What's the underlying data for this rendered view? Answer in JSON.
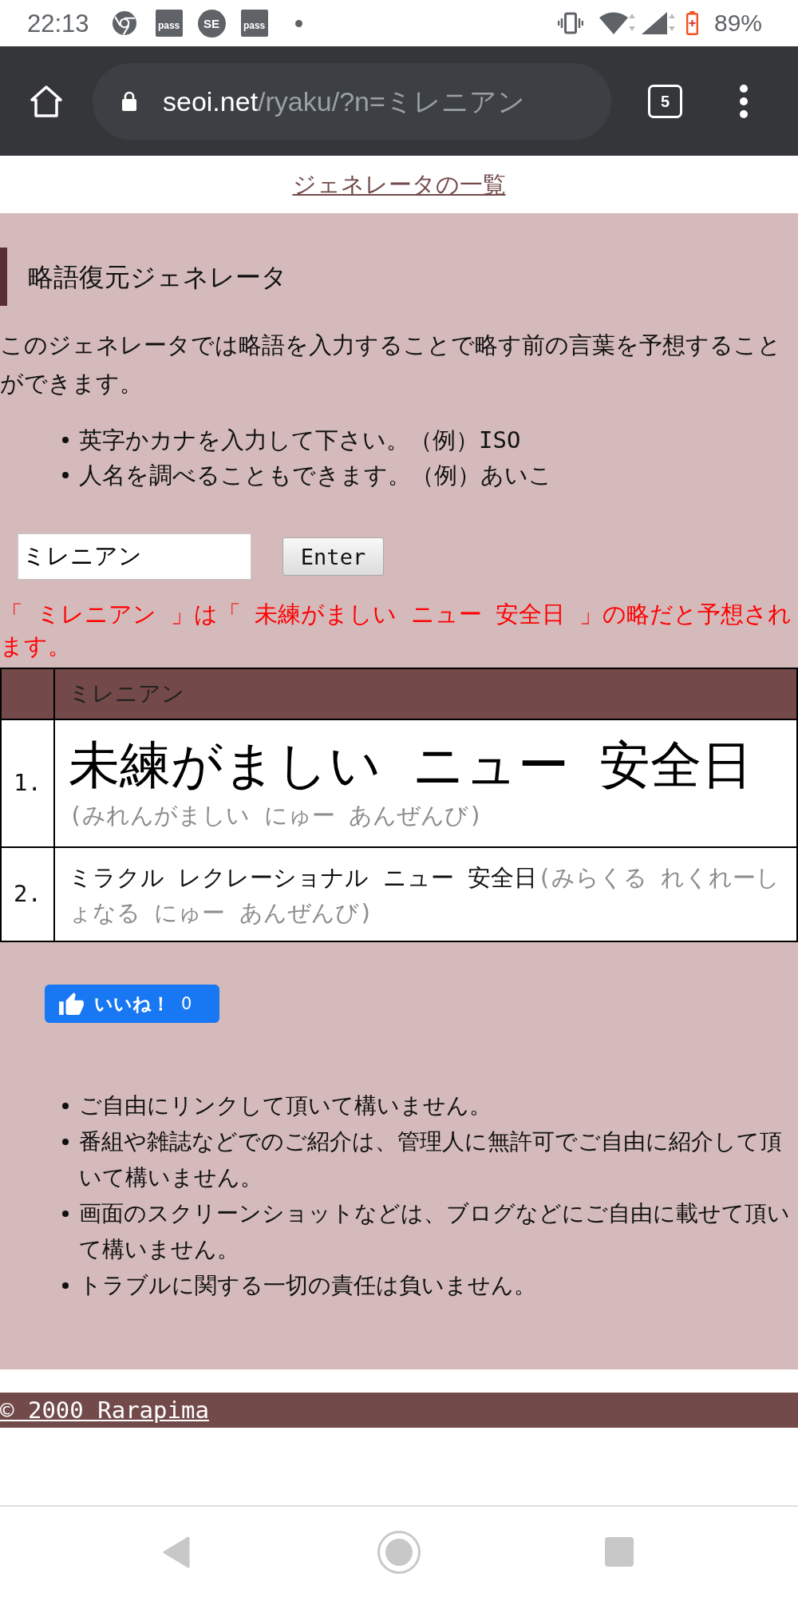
{
  "status_bar": {
    "time": "22:13",
    "notifications": [
      {
        "kind": "browser"
      },
      {
        "kind": "ticket",
        "label": "pass"
      },
      {
        "kind": "round",
        "label": "SE"
      },
      {
        "kind": "ticket",
        "label": "pass"
      },
      {
        "kind": "dot"
      }
    ],
    "battery": "89%"
  },
  "browser_bar": {
    "url_host": "seoi.net",
    "url_path": "/ryaku/?n=ミレニアン",
    "tab_count": "5"
  },
  "top_link": "ジェネレータの一覧",
  "heading": "略語復元ジェネレータ",
  "intro": "このジェネレータでは略語を入力することで略す前の言葉を予想することができます。",
  "hints": [
    "英字かカナを入力して下さい。（例）ISO",
    "人名を調べることもできます。（例）あいこ"
  ],
  "search": {
    "value": "ミレニアン",
    "button": "Enter"
  },
  "result_message": "「 ミレニアン 」は「 未練がましい ニュー 安全日 」の略だと予想されます。",
  "table": {
    "header": "ミレニアン",
    "rows": [
      {
        "kind": "featured",
        "number": "1.",
        "phrase": "未練がましい ニュー 安全日",
        "reading": "(みれんがましい にゅー あんぜんび)"
      },
      {
        "kind": "plain",
        "number": "2.",
        "phrase": "ミラクル レクレーショナル ニュー 安全日",
        "reading": "(みらくる れくれーしょなる にゅー あんぜんび)"
      }
    ]
  },
  "like_button": {
    "label": "いいね！",
    "count": "0"
  },
  "notes": [
    "ご自由にリンクして頂いて構いません。",
    "番組や雑誌などでのご紹介は、管理人に無許可でご自由に紹介して頂いて構いません。",
    "画面のスクリーンショットなどは、ブログなどにご自由に載せて頂いて構いません。",
    "トラブルに関する一切の責任は負いません。"
  ],
  "footer": "© 2000 Rarapima"
}
